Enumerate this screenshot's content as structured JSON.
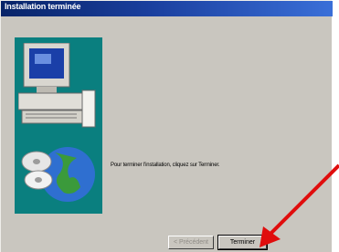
{
  "window": {
    "title": "Installation terminée",
    "message": "Pour terminer l'installation, cliquez sur Terminer.",
    "colors": {
      "titlebar": "#1a3f9e",
      "panel": "#0a7f7f",
      "face": "#c9c6bf",
      "arrow": "#e00d0d"
    }
  },
  "buttons": {
    "back_label": "< Précédent",
    "finish_label": "Terminer"
  },
  "annotation": {
    "icon": "red-arrow-pointing-to-finish"
  }
}
